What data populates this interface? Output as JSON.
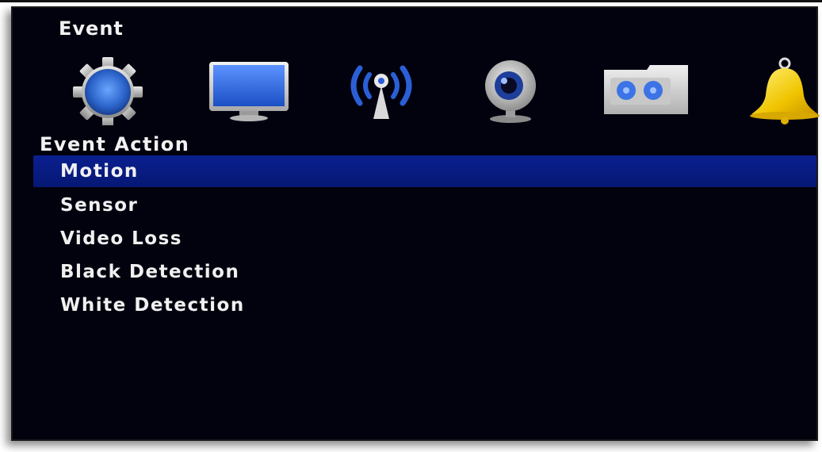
{
  "menu": {
    "title": "Event",
    "icons": [
      {
        "name": "gear-icon"
      },
      {
        "name": "monitor-icon"
      },
      {
        "name": "network-icon"
      },
      {
        "name": "camera-icon"
      },
      {
        "name": "recorder-icon"
      },
      {
        "name": "bell-icon"
      }
    ]
  },
  "section": {
    "title": "Event Action",
    "items": [
      {
        "label": "Motion",
        "selected": true
      },
      {
        "label": "Sensor",
        "selected": false
      },
      {
        "label": "Video Loss",
        "selected": false
      },
      {
        "label": "Black Detection",
        "selected": false
      },
      {
        "label": "White Detection",
        "selected": false
      }
    ]
  },
  "colors": {
    "background": "#02020f",
    "highlight": "#0a1f8f",
    "text": "#f0f0f0"
  }
}
